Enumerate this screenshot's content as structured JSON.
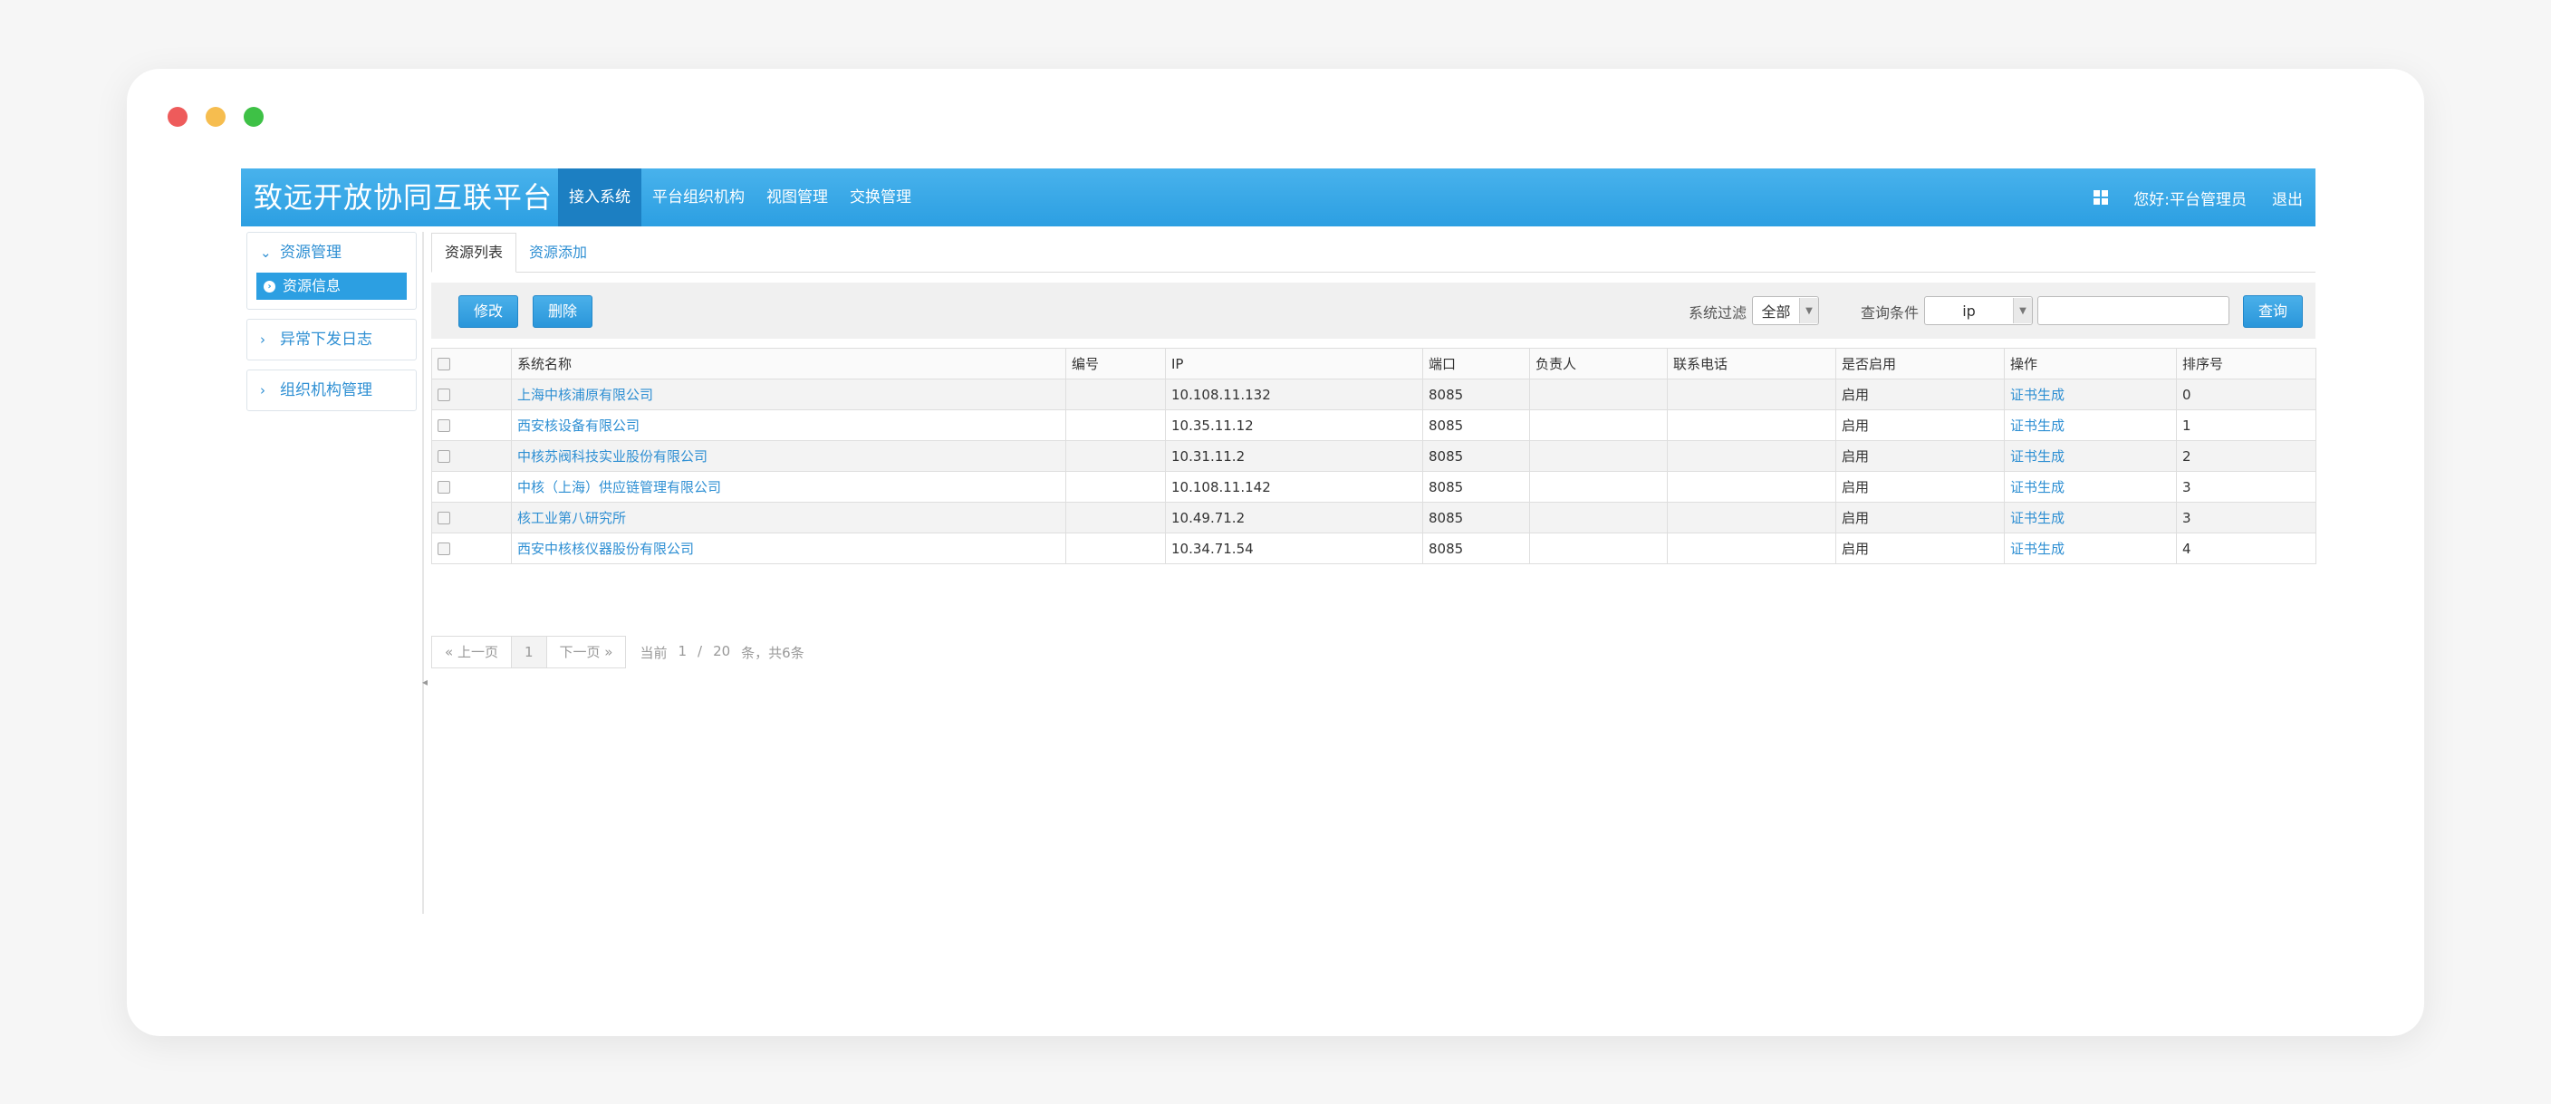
{
  "header": {
    "brand": "致远开放协同互联平台",
    "nav": [
      "接入系统",
      "平台组织机构",
      "视图管理",
      "交换管理"
    ],
    "greeting": "您好:平台管理员",
    "logout": "退出"
  },
  "sidebar": {
    "group1": {
      "title": "资源管理",
      "sub": "资源信息"
    },
    "group2": {
      "title": "异常下发日志"
    },
    "group3": {
      "title": "组织机构管理"
    }
  },
  "tabs": [
    "资源列表",
    "资源添加"
  ],
  "toolbar": {
    "edit": "修改",
    "delete": "删除",
    "filter_label": "系统过滤",
    "filter_value": "全部",
    "query_label": "查询条件",
    "query_field": "ip",
    "search": "查询"
  },
  "table": {
    "headers": [
      "系统名称",
      "编号",
      "IP",
      "端口",
      "负责人",
      "联系电话",
      "是否启用",
      "操作",
      "排序号"
    ],
    "rows": [
      [
        "上海中核浦原有限公司",
        "",
        "10.108.11.132",
        "8085",
        "",
        "",
        "启用",
        "证书生成",
        "0"
      ],
      [
        "西安核设备有限公司",
        "",
        "10.35.11.12",
        "8085",
        "",
        "",
        "启用",
        "证书生成",
        "1"
      ],
      [
        "中核苏阀科技实业股份有限公司",
        "",
        "10.31.11.2",
        "8085",
        "",
        "",
        "启用",
        "证书生成",
        "2"
      ],
      [
        "中核（上海）供应链管理有限公司",
        "",
        "10.108.11.142",
        "8085",
        "",
        "",
        "启用",
        "证书生成",
        "3"
      ],
      [
        "核工业第八研究所",
        "",
        "10.49.71.2",
        "8085",
        "",
        "",
        "启用",
        "证书生成",
        "3"
      ],
      [
        "西安中核核仪器股份有限公司",
        "",
        "10.34.71.54",
        "8085",
        "",
        "",
        "启用",
        "证书生成",
        "4"
      ]
    ]
  },
  "pager": {
    "prev": "« 上一页",
    "page": "1",
    "next": "下一页 »",
    "current_label": "当前",
    "current": "1",
    "slash": "/",
    "total": "20",
    "summary": "条，共6条"
  }
}
